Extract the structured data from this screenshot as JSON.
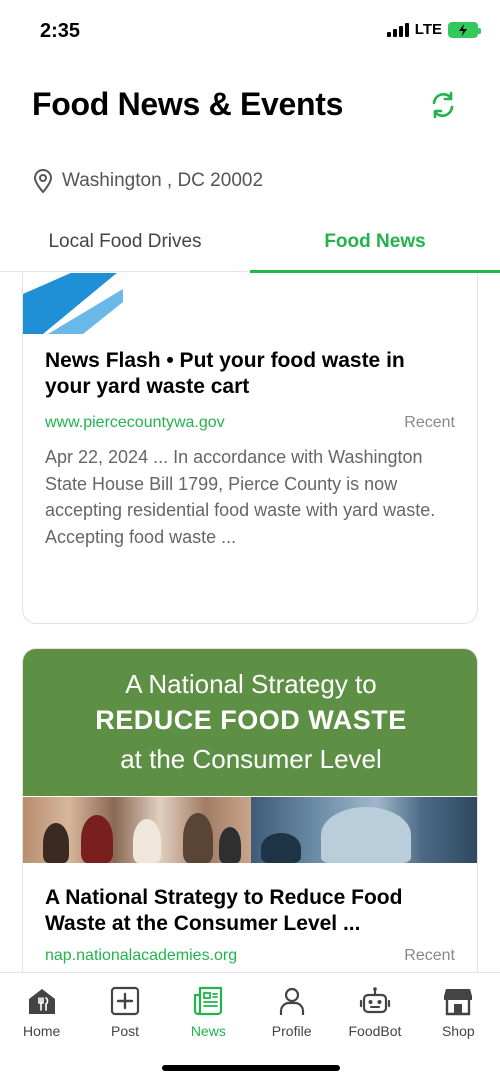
{
  "status_bar": {
    "time": "2:35",
    "network": "LTE",
    "battery_state": "charging",
    "battery_color": "#34c759"
  },
  "header": {
    "title": "Food News & Events",
    "refresh_icon": "refresh-icon"
  },
  "location": {
    "icon": "location-pin-icon",
    "text": "Washington , DC 20002"
  },
  "tabs": [
    {
      "label": "Local Food Drives",
      "active": false
    },
    {
      "label": "Food News",
      "active": true
    }
  ],
  "accent_color": "#22b34d",
  "articles": [
    {
      "title": "News Flash • Put your food waste in your yard waste cart",
      "source": "www.piercecountywa.gov",
      "badge": "Recent",
      "snippet": "Apr 22, 2024 ... In accordance with Washington State House Bill 1799, Pierce County is now accepting residential food waste with yard waste. Accepting food waste ..."
    },
    {
      "banner": {
        "line1": "A National Strategy to",
        "line2": "REDUCE FOOD WASTE",
        "line3": "at the Consumer Level",
        "color": "#5d8f45"
      },
      "title": "A National Strategy to Reduce Food Waste at the Consumer Level ...",
      "source": "nap.nationalacademies.org",
      "badge": "Recent"
    }
  ],
  "bottom_nav": [
    {
      "label": "Home",
      "icon": "home-icon",
      "active": false
    },
    {
      "label": "Post",
      "icon": "plus-square-icon",
      "active": false
    },
    {
      "label": "News",
      "icon": "newspaper-icon",
      "active": true
    },
    {
      "label": "Profile",
      "icon": "person-icon",
      "active": false
    },
    {
      "label": "FoodBot",
      "icon": "robot-icon",
      "active": false
    },
    {
      "label": "Shop",
      "icon": "store-icon",
      "active": false
    }
  ]
}
